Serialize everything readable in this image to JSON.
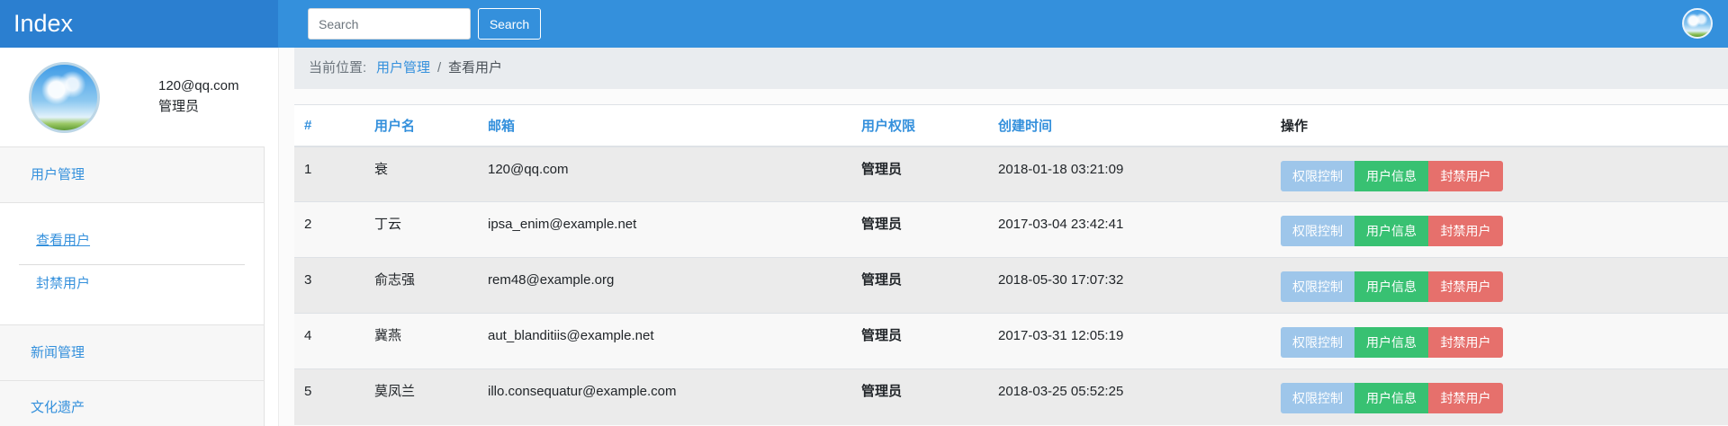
{
  "header": {
    "brand": "Index",
    "search": {
      "placeholder": "Search",
      "button_label": "Search"
    }
  },
  "profile": {
    "email": "120@qq.com",
    "role": "管理员"
  },
  "sidebar": {
    "menus": [
      {
        "label": "用户管理",
        "expanded": true,
        "children": [
          {
            "label": "查看用户",
            "active": true
          },
          {
            "label": "封禁用户",
            "active": false
          }
        ]
      },
      {
        "label": "新闻管理"
      },
      {
        "label": "文化遗产"
      }
    ]
  },
  "breadcrumb": {
    "prefix": "当前位置:",
    "separator": "/",
    "items": [
      "用户管理",
      "查看用户"
    ]
  },
  "table": {
    "headers": [
      "#",
      "用户名",
      "邮箱",
      "用户权限",
      "创建时间",
      "操作"
    ],
    "rows": [
      {
        "id": "1",
        "username": "衰",
        "email": "120@qq.com",
        "role": "管理员",
        "created_at": "2018-01-18 03:21:09"
      },
      {
        "id": "2",
        "username": "丁云",
        "email": "ipsa_enim@example.net",
        "role": "管理员",
        "created_at": "2017-03-04 23:42:41"
      },
      {
        "id": "3",
        "username": "俞志强",
        "email": "rem48@example.org",
        "role": "管理员",
        "created_at": "2018-05-30 17:07:32"
      },
      {
        "id": "4",
        "username": "冀燕",
        "email": "aut_blanditiis@example.net",
        "role": "管理员",
        "created_at": "2017-03-31 12:05:19"
      },
      {
        "id": "5",
        "username": "莫凤兰",
        "email": "illo.consequatur@example.com",
        "role": "管理员",
        "created_at": "2018-03-25 05:52:25"
      }
    ],
    "actions": {
      "permission": "权限控制",
      "info": "用户信息",
      "ban": "封禁用户"
    }
  },
  "colors": {
    "primary": "#3490dc",
    "brand_bg": "#2b7fd0",
    "permission_button": "#9ec6ea",
    "info_button": "#38c172",
    "ban_button": "#e6706c"
  }
}
